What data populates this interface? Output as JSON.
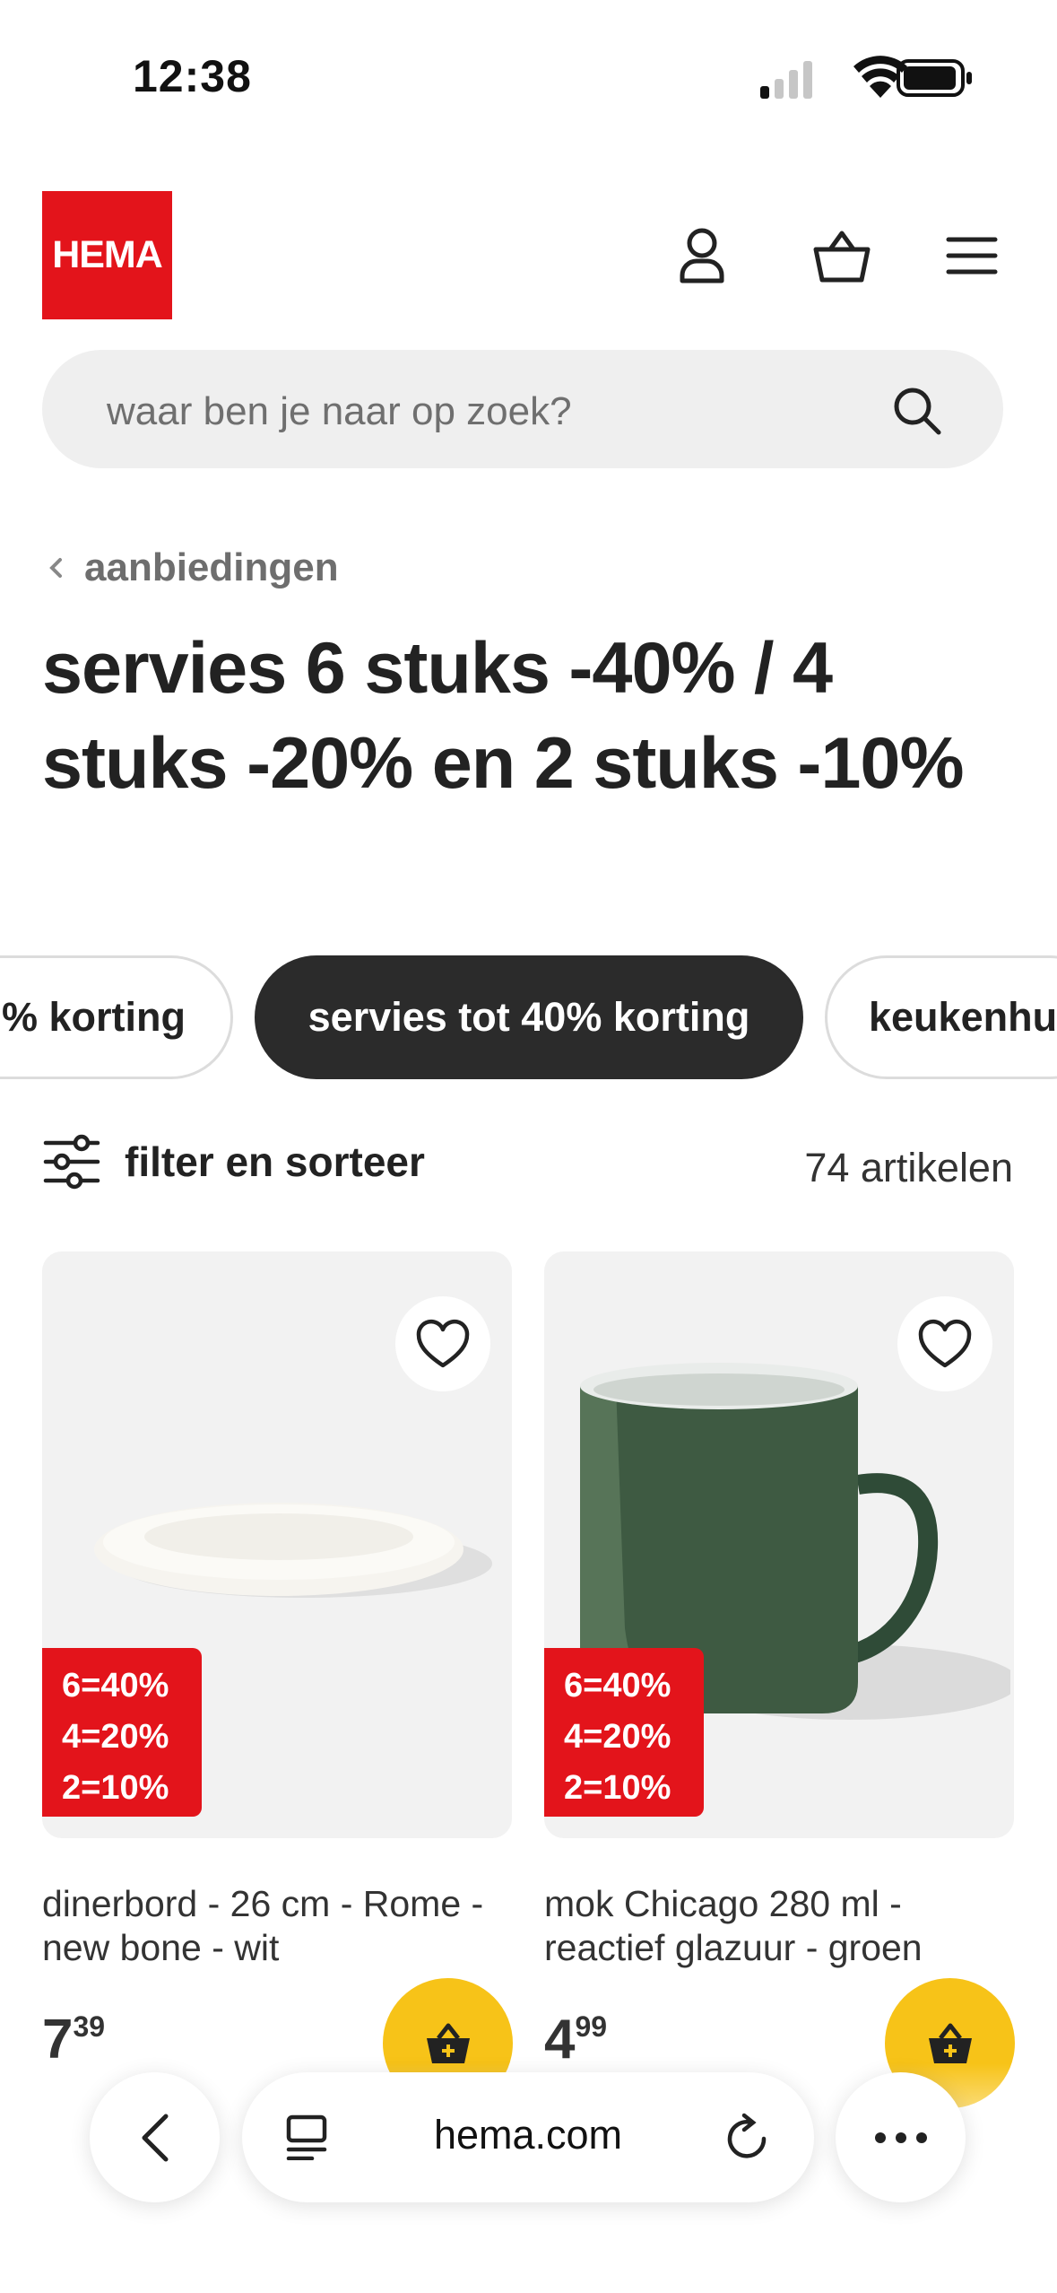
{
  "status_bar": {
    "time": "12:38"
  },
  "header": {
    "logo": "HEMA"
  },
  "search": {
    "placeholder": "waar ben je naar op zoek?"
  },
  "breadcrumb": {
    "label": "aanbiedingen"
  },
  "page_title": "servies 6 stuks -40% / 4 stuks -20% en 2 stuks -10%",
  "chips": [
    {
      "label": "% korting",
      "active": false
    },
    {
      "label": "servies tot 40% korting",
      "active": true
    },
    {
      "label": "keukenhu",
      "active": false
    }
  ],
  "filter": {
    "label": "filter en sorteer",
    "count": "74 artikelen"
  },
  "products": [
    {
      "badge": [
        "6=40%",
        "4=20%",
        "2=10%"
      ],
      "name": "dinerbord - 26 cm - Rome - new bone - wit",
      "price_euros": "7",
      "price_cents": "39"
    },
    {
      "badge": [
        "6=40%",
        "4=20%",
        "2=10%"
      ],
      "name": "mok Chicago 280 ml - reactief glazuur - groen",
      "price_euros": "4",
      "price_cents": "99"
    }
  ],
  "browser": {
    "url": "hema.com"
  },
  "colors": {
    "brand": "#e3141b",
    "cart_button": "#f7c318",
    "active_chip": "#2b2b2b"
  }
}
